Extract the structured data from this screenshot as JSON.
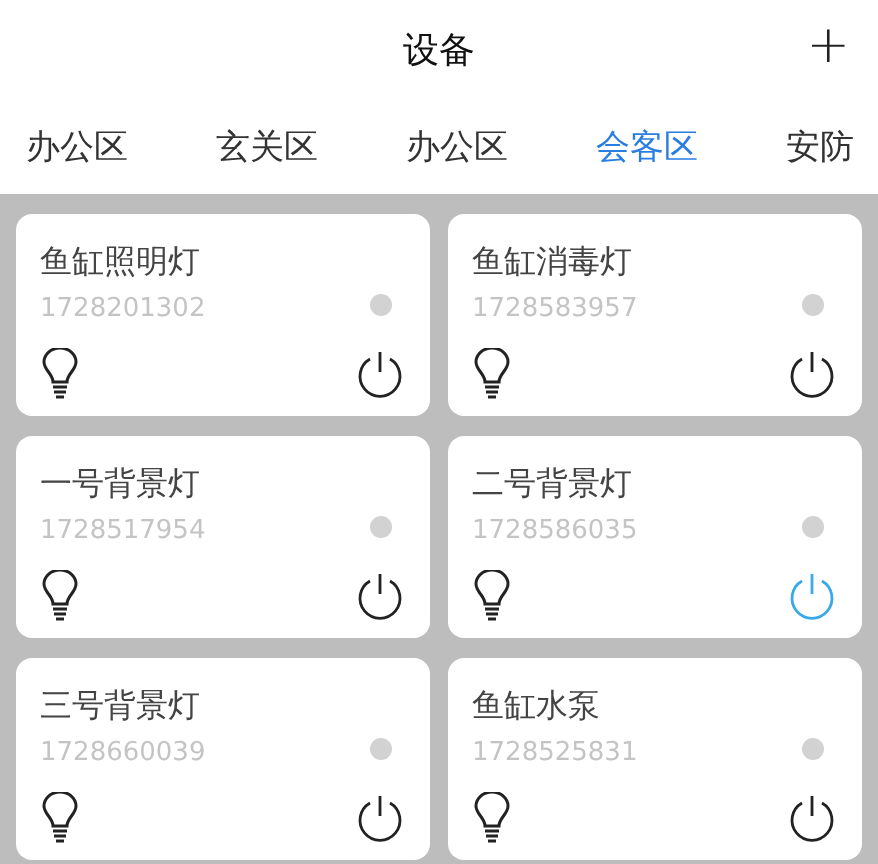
{
  "header": {
    "title": "设备",
    "add_icon": "+"
  },
  "tabs": [
    {
      "label": "办公区",
      "selected": false
    },
    {
      "label": "玄关区",
      "selected": false
    },
    {
      "label": "办公区",
      "selected": false
    },
    {
      "label": "会客区",
      "selected": true
    },
    {
      "label": "安防",
      "selected": false
    }
  ],
  "devices": [
    {
      "name": "鱼缸照明灯",
      "id": "1728201302",
      "on": false
    },
    {
      "name": "鱼缸消毒灯",
      "id": "1728583957",
      "on": false
    },
    {
      "name": "一号背景灯",
      "id": "1728517954",
      "on": false
    },
    {
      "name": "二号背景灯",
      "id": "1728586035",
      "on": true
    },
    {
      "name": "三号背景灯",
      "id": "1728660039",
      "on": false
    },
    {
      "name": "鱼缸水泵",
      "id": "1728525831",
      "on": false
    }
  ]
}
